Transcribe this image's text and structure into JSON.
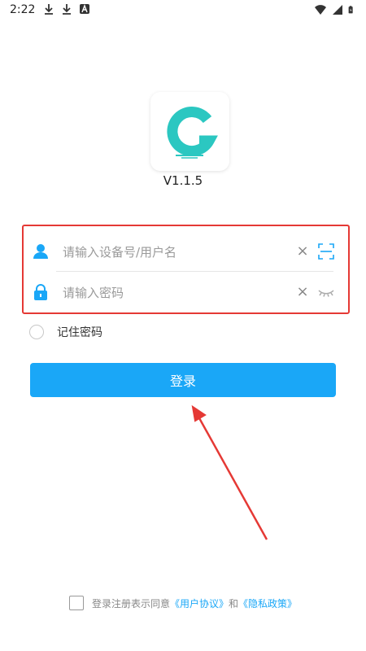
{
  "status_bar": {
    "time": "2:22",
    "icons_left": [
      "download-icon",
      "download-icon",
      "app-store-icon"
    ],
    "icons_right": [
      "wifi-icon",
      "signal-icon",
      "battery-icon"
    ]
  },
  "app": {
    "version": "V1.1.5",
    "logo": "g-logo-icon"
  },
  "login_form": {
    "username": {
      "placeholder": "请输入设备号/用户名",
      "value": ""
    },
    "password": {
      "placeholder": "请输入密码",
      "value": ""
    },
    "clear_glyph": "×",
    "remember_label": "记住密码",
    "submit_label": "登录"
  },
  "agreement": {
    "prefix": "登录注册表示同意",
    "link_user": "《用户协议》",
    "conjunction": "和",
    "link_privacy": "《隐私政策》"
  },
  "colors": {
    "accent": "#1aa7f7",
    "logo_teal": "#2bc7c1",
    "highlight": "#e53935"
  }
}
